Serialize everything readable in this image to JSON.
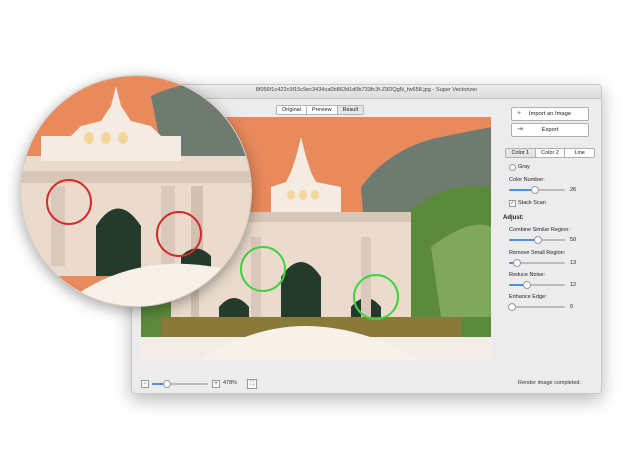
{
  "window": {
    "title": "8f056f1c422c9f15c9ec3434ca0b863d1d0b733fc3f-Z9DQgN_fw658.jpg - Super Vectorizer"
  },
  "view_modes": {
    "items": [
      "Original",
      "Preview",
      "Result"
    ],
    "selected": "Result"
  },
  "sidebar": {
    "import_label": "Import an Image",
    "import_icon": "plus-icon",
    "export_label": "Export",
    "export_icon": "export-icon",
    "tabs": [
      "Color 1",
      "Color 2",
      "Line"
    ],
    "selected_tab": "Color 1",
    "gray_label": "Gray",
    "color_number_label": "Color Number:",
    "color_number_value": 26,
    "color_number_fraction": 0.45,
    "stack_scan_label": "Stack Scan",
    "stack_scan_checked": true,
    "adjust_heading": "Adjust:",
    "combine_label": "Combine Similar Region:",
    "combine_value": 50,
    "combine_fraction": 0.5,
    "remove_label": "Remove Small Region:",
    "remove_value": 13,
    "remove_fraction": 0.12,
    "noise_label": "Reduce Noise:",
    "noise_value": 12,
    "noise_fraction": 0.3,
    "enhance_label": "Enhance Edge:",
    "enhance_value": 0,
    "enhance_fraction": 0.0
  },
  "bottom": {
    "zoom_out": "−",
    "zoom_in": "+",
    "zoom_value": "478%",
    "zoom_fraction": 0.3,
    "fit_icon": "fit-screen-icon",
    "status": "Render image completed."
  },
  "colors": {
    "sky_orange": "#e98a5c",
    "tree_gray": "#6d7b70",
    "grass_green": "#5c8a3c",
    "arch_dark": "#243a2c",
    "building_cream": "#eadbcc",
    "olive": "#8a7a3a",
    "highlight_red": "#d32a2a",
    "highlight_green": "#3fd33f",
    "accent_blue": "#4a90e2"
  }
}
